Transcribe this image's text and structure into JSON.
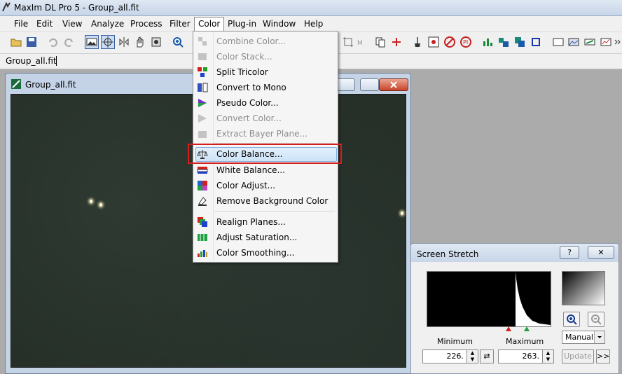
{
  "window": {
    "title": "MaxIm DL Pro 5 - Group_all.fit"
  },
  "menubar": {
    "items": [
      "File",
      "Edit",
      "View",
      "Analyze",
      "Process",
      "Filter",
      "Color",
      "Plug-in",
      "Window",
      "Help"
    ],
    "active": "Color"
  },
  "tabbar": {
    "tab_label": "Group_all.fit"
  },
  "image_window": {
    "title": "Group_all.fit"
  },
  "color_menu": {
    "items": [
      {
        "label": "Combine Color...",
        "enabled": false,
        "icon": "combine-color-icon"
      },
      {
        "label": "Color Stack...",
        "enabled": false,
        "icon": "color-stack-icon"
      },
      {
        "label": "Split Tricolor",
        "enabled": true,
        "icon": "split-tricolor-icon"
      },
      {
        "label": "Convert to Mono",
        "enabled": true,
        "icon": "convert-mono-icon"
      },
      {
        "label": "Pseudo Color...",
        "enabled": true,
        "icon": "pseudo-color-icon"
      },
      {
        "label": "Convert Color...",
        "enabled": false,
        "icon": "convert-color-icon"
      },
      {
        "label": "Extract Bayer Plane...",
        "enabled": false,
        "icon": "bayer-plane-icon"
      },
      {
        "label": "Color Balance...",
        "enabled": true,
        "icon": "color-balance-icon",
        "highlighted": true
      },
      {
        "label": "White Balance...",
        "enabled": true,
        "icon": "white-balance-icon"
      },
      {
        "label": "Color Adjust...",
        "enabled": true,
        "icon": "color-adjust-icon"
      },
      {
        "label": "Remove Background Color",
        "enabled": true,
        "icon": "remove-background-icon"
      },
      {
        "label": "Realign Planes...",
        "enabled": true,
        "icon": "realign-planes-icon"
      },
      {
        "label": "Adjust Saturation...",
        "enabled": true,
        "icon": "adjust-saturation-icon"
      },
      {
        "label": "Color Smoothing...",
        "enabled": true,
        "icon": "color-smoothing-icon"
      }
    ]
  },
  "screen_stretch": {
    "title": "Screen Stretch",
    "help_button": "?",
    "close_button": "✕",
    "minimum_label": "Minimum",
    "maximum_label": "Maximum",
    "minimum_value": "226.",
    "maximum_value": "263.",
    "mode": "Manual",
    "update_label": "Update",
    "expand_label": ">>",
    "swap_label": "⇄"
  },
  "colors": {
    "highlight_border": "#d41f1f",
    "menu_highlight": "#cde3f8",
    "image_bg": "#263028"
  }
}
